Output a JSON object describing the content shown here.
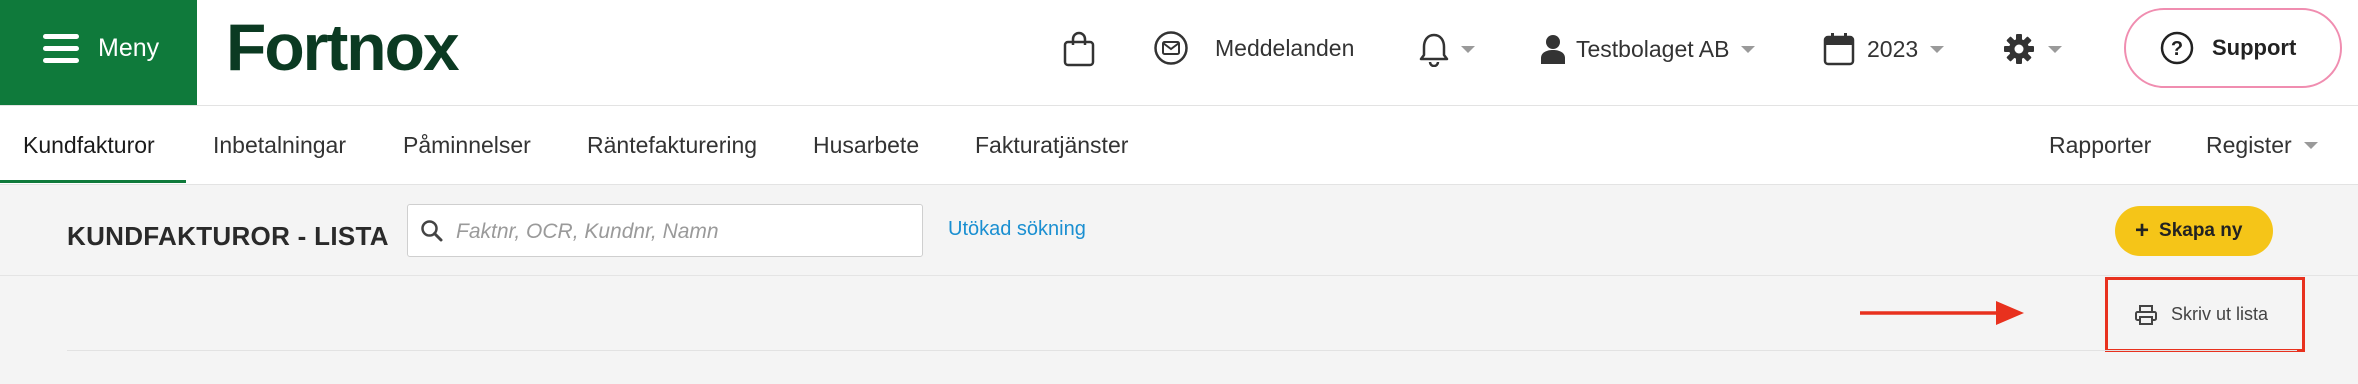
{
  "topbar": {
    "menu_label": "Meny",
    "logo_text": "Fortnox",
    "cart_icon": "shopping-bag-icon",
    "messages_label": "Meddelanden",
    "notifications_icon": "bell-icon",
    "company_label": "Testbolaget AB",
    "year_label": "2023",
    "settings_icon": "gear-icon",
    "support_label": "Support"
  },
  "nav": {
    "tabs": [
      {
        "label": "Kundfakturor",
        "active": true
      },
      {
        "label": "Inbetalningar"
      },
      {
        "label": "Påminnelser"
      },
      {
        "label": "Räntefakturering"
      },
      {
        "label": "Husarbete"
      },
      {
        "label": "Fakturatjänster"
      }
    ],
    "right": [
      {
        "label": "Rapporter"
      },
      {
        "label": "Register"
      }
    ]
  },
  "content": {
    "title": "KUNDFAKTUROR - LISTA",
    "search_placeholder": "Faktnr, OCR, Kundnr, Namn",
    "advanced_search": "Utökad sökning",
    "create_label": "Skapa ny",
    "print_label": "Skriv ut lista"
  },
  "colors": {
    "brand_green": "#0f7a3b",
    "logo_dark": "#0b3a22",
    "accent_yellow": "#f5c518",
    "link_blue": "#1a8fd1",
    "highlight_red": "#e8311e",
    "support_border": "#f08db0"
  }
}
